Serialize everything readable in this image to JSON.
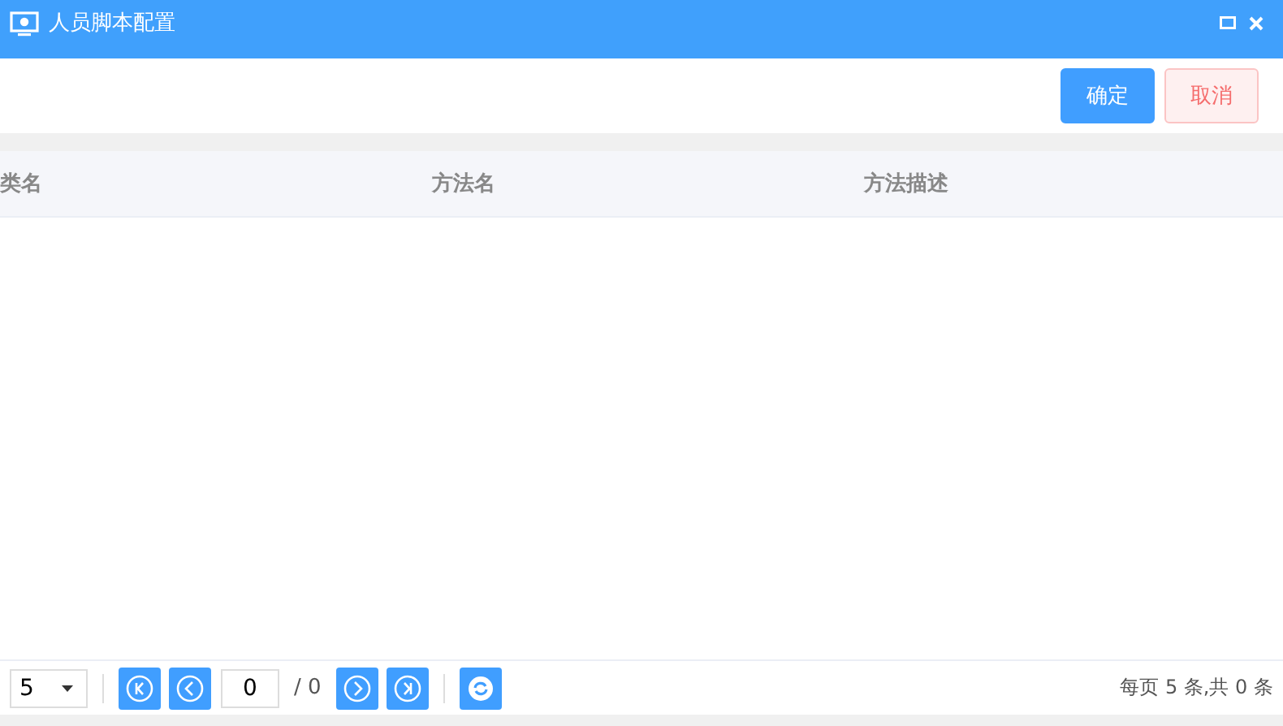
{
  "window": {
    "title": "人员脚本配置"
  },
  "buttons": [
    {
      "label": "确定",
      "kind": "primary"
    },
    {
      "label": "取消",
      "kind": "danger"
    }
  ],
  "table": {
    "columns": [
      "类名",
      "方法名",
      "方法描述"
    ]
  },
  "pagination": {
    "page_size": "5",
    "page": "0",
    "total_pages": "/ 0",
    "summary": "每页 5 条,共 0 条"
  }
}
